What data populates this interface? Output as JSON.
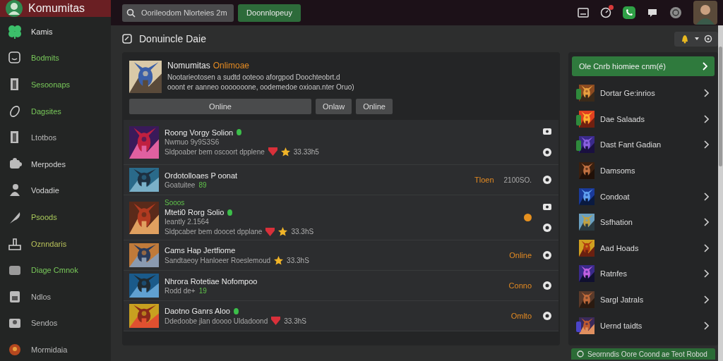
{
  "app": {
    "name": "Komumitas"
  },
  "search": {
    "placeholder": "Oorileodom Nlorteies 2m"
  },
  "top_button": {
    "label": "Doonnlopeuy"
  },
  "notifications": {
    "unread": true
  },
  "sidebar": {
    "items": [
      {
        "label": "Kamis",
        "color": "#e4e4e4"
      },
      {
        "label": "Bodmits",
        "color": "#79c95a"
      },
      {
        "label": "Sesoonaps",
        "color": "#79c95a"
      },
      {
        "label": "Dagsites",
        "color": "#79c95a"
      },
      {
        "label": "Ltotbos",
        "color": "#b8b8b8"
      },
      {
        "label": "Merpodes",
        "color": "#d4d4d4"
      },
      {
        "label": "Vodadie",
        "color": "#d4d4d4"
      },
      {
        "label": "Psoods",
        "color": "#a9c95a"
      },
      {
        "label": "Oznndaris",
        "color": "#b9c25a"
      },
      {
        "label": "Diage Cmnok",
        "color": "#79c95a"
      },
      {
        "label": "Ndlos",
        "color": "#b8b8b8"
      },
      {
        "label": "Sendos",
        "color": "#b8b8b8"
      },
      {
        "label": "Mormidaia",
        "color": "#b8b8b8"
      }
    ]
  },
  "page": {
    "title": "Donuincle Daie"
  },
  "featured": {
    "title": "Nomumitas",
    "status": "Onlimoae",
    "description": "Nootarieotosen a sudtd ooteoo aforgpod Doochteobrt.d ooont er aanneo ooooooone, oodemedoe oxioan.nter Oruo)",
    "buttons": [
      {
        "label": "Online",
        "kind": "wide"
      },
      {
        "label": "Onlaw",
        "kind": "small"
      },
      {
        "label": "Online",
        "kind": "small"
      }
    ]
  },
  "rows": [
    {
      "kind": "tall",
      "title": "Roong Vorgy Solion",
      "online": true,
      "subtitle": "Nwmuo 9y9S3S6",
      "meta": "Sldpoaber bem oscoort dpplene",
      "shield": true,
      "starred": true,
      "stat": "33.33h5"
    },
    {
      "kind": "compact",
      "title": "Ordotolloaes P oonat",
      "online": false,
      "subtitle": "Goatuitee",
      "count": "89",
      "status": "Tloen",
      "value": "2100SO."
    },
    {
      "kind": "tall",
      "tag": "Sooos",
      "title": "Mteti0 Rorg Solio",
      "online": true,
      "subtitle": "Ieantly 2.1564",
      "meta": "Sldpcaber bem doocet dpplane",
      "shield": true,
      "starred": true,
      "stat": "33.3hS",
      "alert": true
    },
    {
      "kind": "compact",
      "title": "Cams Hap Jertfiome",
      "online": false,
      "subtitle": "Sandtaeoy Hanloeer  Roeslemoud",
      "starred": true,
      "stat": "33.3hS",
      "status": "Online"
    },
    {
      "kind": "compact",
      "title": "Nhrora Rotetiae Nofompoo",
      "online": false,
      "subtitle": "Rodd de+",
      "count": "19",
      "status": "Conno"
    },
    {
      "kind": "compact",
      "title": "Daotno Ganrs Aloo",
      "online": true,
      "subtitle": "Ddedoobe jlan doooo Uldadoond",
      "shield": true,
      "stat": "33.3hS",
      "status": "Omlto"
    }
  ],
  "side_panel": {
    "button": {
      "label": "Ole Cnrb hiomiee cnm(é)"
    },
    "items": [
      {
        "label": "Dortar Ge:inrios",
        "chevron": true,
        "color": "#2f8a3c"
      },
      {
        "label": "Dae Salaads",
        "chevron": true,
        "color": "#2f8a3c"
      },
      {
        "label": "Dast Fant Gadian",
        "chevron": true,
        "color": "#2f8a3c"
      },
      {
        "label": "Damsoms",
        "chevron": false
      },
      {
        "label": "Condoat",
        "chevron": true
      },
      {
        "label": "Ssfhation",
        "chevron": true
      },
      {
        "label": "Aad Hoads",
        "chevron": true
      },
      {
        "label": "Ratnfes",
        "chevron": true
      },
      {
        "label": "Sargl Jatrals",
        "chevron": true
      },
      {
        "label": "Uernd taidts",
        "chevron": true,
        "color": "#4a44c8"
      }
    ]
  },
  "footer": {
    "text": "Seornndis Oore Coond ae Teot Robod"
  }
}
